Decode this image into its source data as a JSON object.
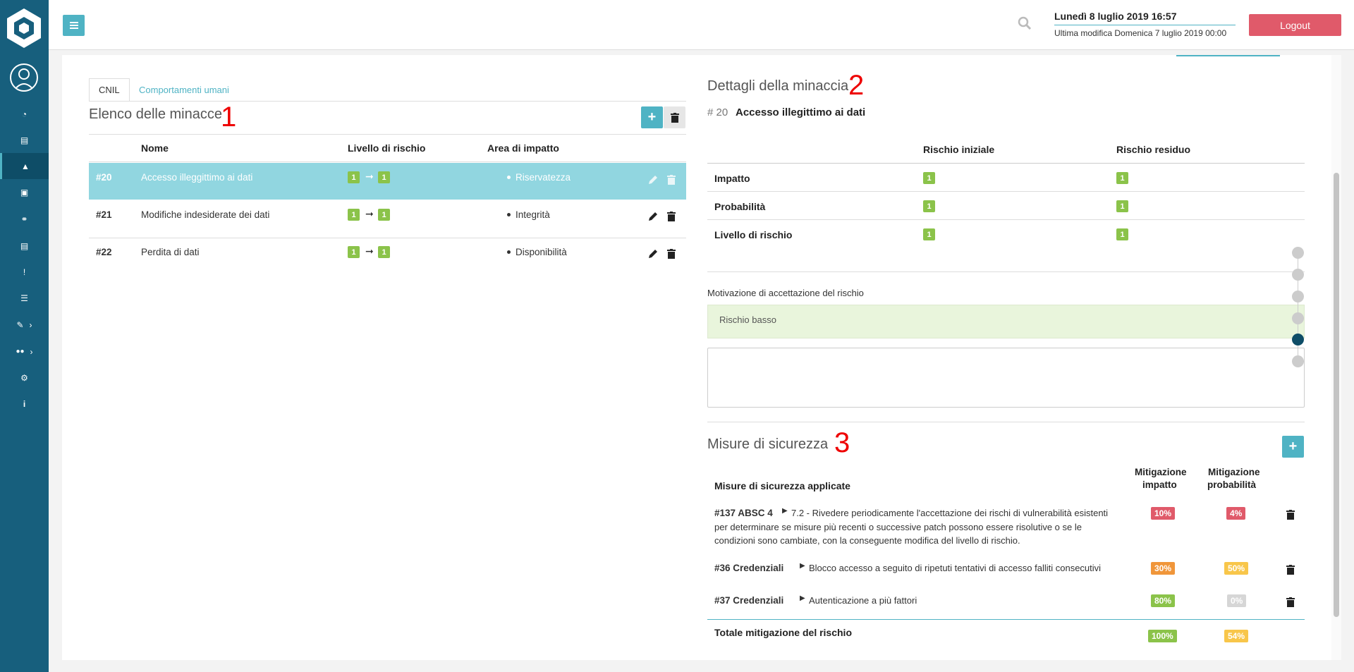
{
  "header": {
    "date": "Lunedì 8 luglio 2019 16:57",
    "last_modified": "Ultima modifica Domenica 7 luglio 2019 00:00",
    "logout_label": "Logout"
  },
  "sidebar": {
    "items": [
      {
        "name": "dashboard-icon",
        "icon": "◔"
      },
      {
        "name": "document-icon",
        "icon": "▤"
      },
      {
        "name": "warning-icon",
        "icon": "▲",
        "active": true
      },
      {
        "name": "file-icon",
        "icon": "▣"
      },
      {
        "name": "handshake-icon",
        "icon": "⚭"
      },
      {
        "name": "report-icon",
        "icon": "▤"
      },
      {
        "name": "alert-icon",
        "icon": "!"
      },
      {
        "name": "list-icon",
        "icon": "☰"
      },
      {
        "name": "edit-icon",
        "icon": "✎",
        "chevron": true
      },
      {
        "name": "users-icon",
        "icon": "👥",
        "chevron": true
      },
      {
        "name": "gear-icon",
        "icon": "⚙"
      },
      {
        "name": "info-icon",
        "icon": "i"
      }
    ]
  },
  "tabs": [
    "CNIL",
    "Comportamenti umani"
  ],
  "threats": {
    "title": "Elenco delle minacce",
    "number": "1",
    "columns": [
      "Nome",
      "Livello di rischio",
      "Area di impatto"
    ],
    "rows": [
      {
        "id": "#20",
        "name": "Accesso illeggittimo ai dati",
        "from": "1",
        "to": "1",
        "area": "Riservatezza"
      },
      {
        "id": "#21",
        "name": "Modifiche indesiderate dei dati",
        "from": "1",
        "to": "1",
        "area": "Integrità"
      },
      {
        "id": "#22",
        "name": "Perdita di dati",
        "from": "1",
        "to": "1",
        "area": "Disponibilità"
      }
    ]
  },
  "details": {
    "title": "Dettagli della minaccia",
    "number": "2",
    "id": "# 20",
    "name": "Accesso illegittimo ai dati",
    "columns": [
      "Rischio iniziale",
      "Rischio residuo"
    ],
    "rows": [
      {
        "label": "Impatto",
        "initial": "1",
        "residual": "1"
      },
      {
        "label": "Probabilità",
        "initial": "1",
        "residual": "1"
      },
      {
        "label": "Livello di rischio",
        "initial": "1",
        "residual": "1"
      }
    ],
    "acceptance_label": "Motivazione di accettazione del rischio",
    "acceptance_value": "Rischio basso"
  },
  "measures": {
    "title": "Misure di sicurezza",
    "number": "3",
    "columns": {
      "applied": "Misure di sicurezza applicate",
      "impact_l1": "Mitigazione",
      "impact_l2": "impatto",
      "prob_l1": "Mitigazione",
      "prob_l2": "probabilità"
    },
    "rows": [
      {
        "code": "#137  ABSC 4",
        "desc_lines": [
          "7.2 - Rivedere periodicamente l'accettazione dei rischi di vulnerabilità esistenti",
          "per determinare se misure più recenti o successive patch possono essere risolutive o se le",
          "condizioni sono cambiate, con la conseguente modifica del livello di rischio."
        ],
        "impact": "10%",
        "prob": "4%"
      },
      {
        "code": "#36  Credenziali",
        "desc_lines": [
          "Blocco accesso a seguito di ripetuti tentativi di accesso falliti consecutivi"
        ],
        "impact": "30%",
        "prob": "50%"
      },
      {
        "code": "#37  Credenziali",
        "desc_lines": [
          "Autenticazione a più fattori"
        ],
        "impact": "80%",
        "prob": "0%"
      }
    ],
    "total_label": "Totale mitigazione del rischio",
    "total_impact": "100%",
    "total_prob": "54%"
  }
}
